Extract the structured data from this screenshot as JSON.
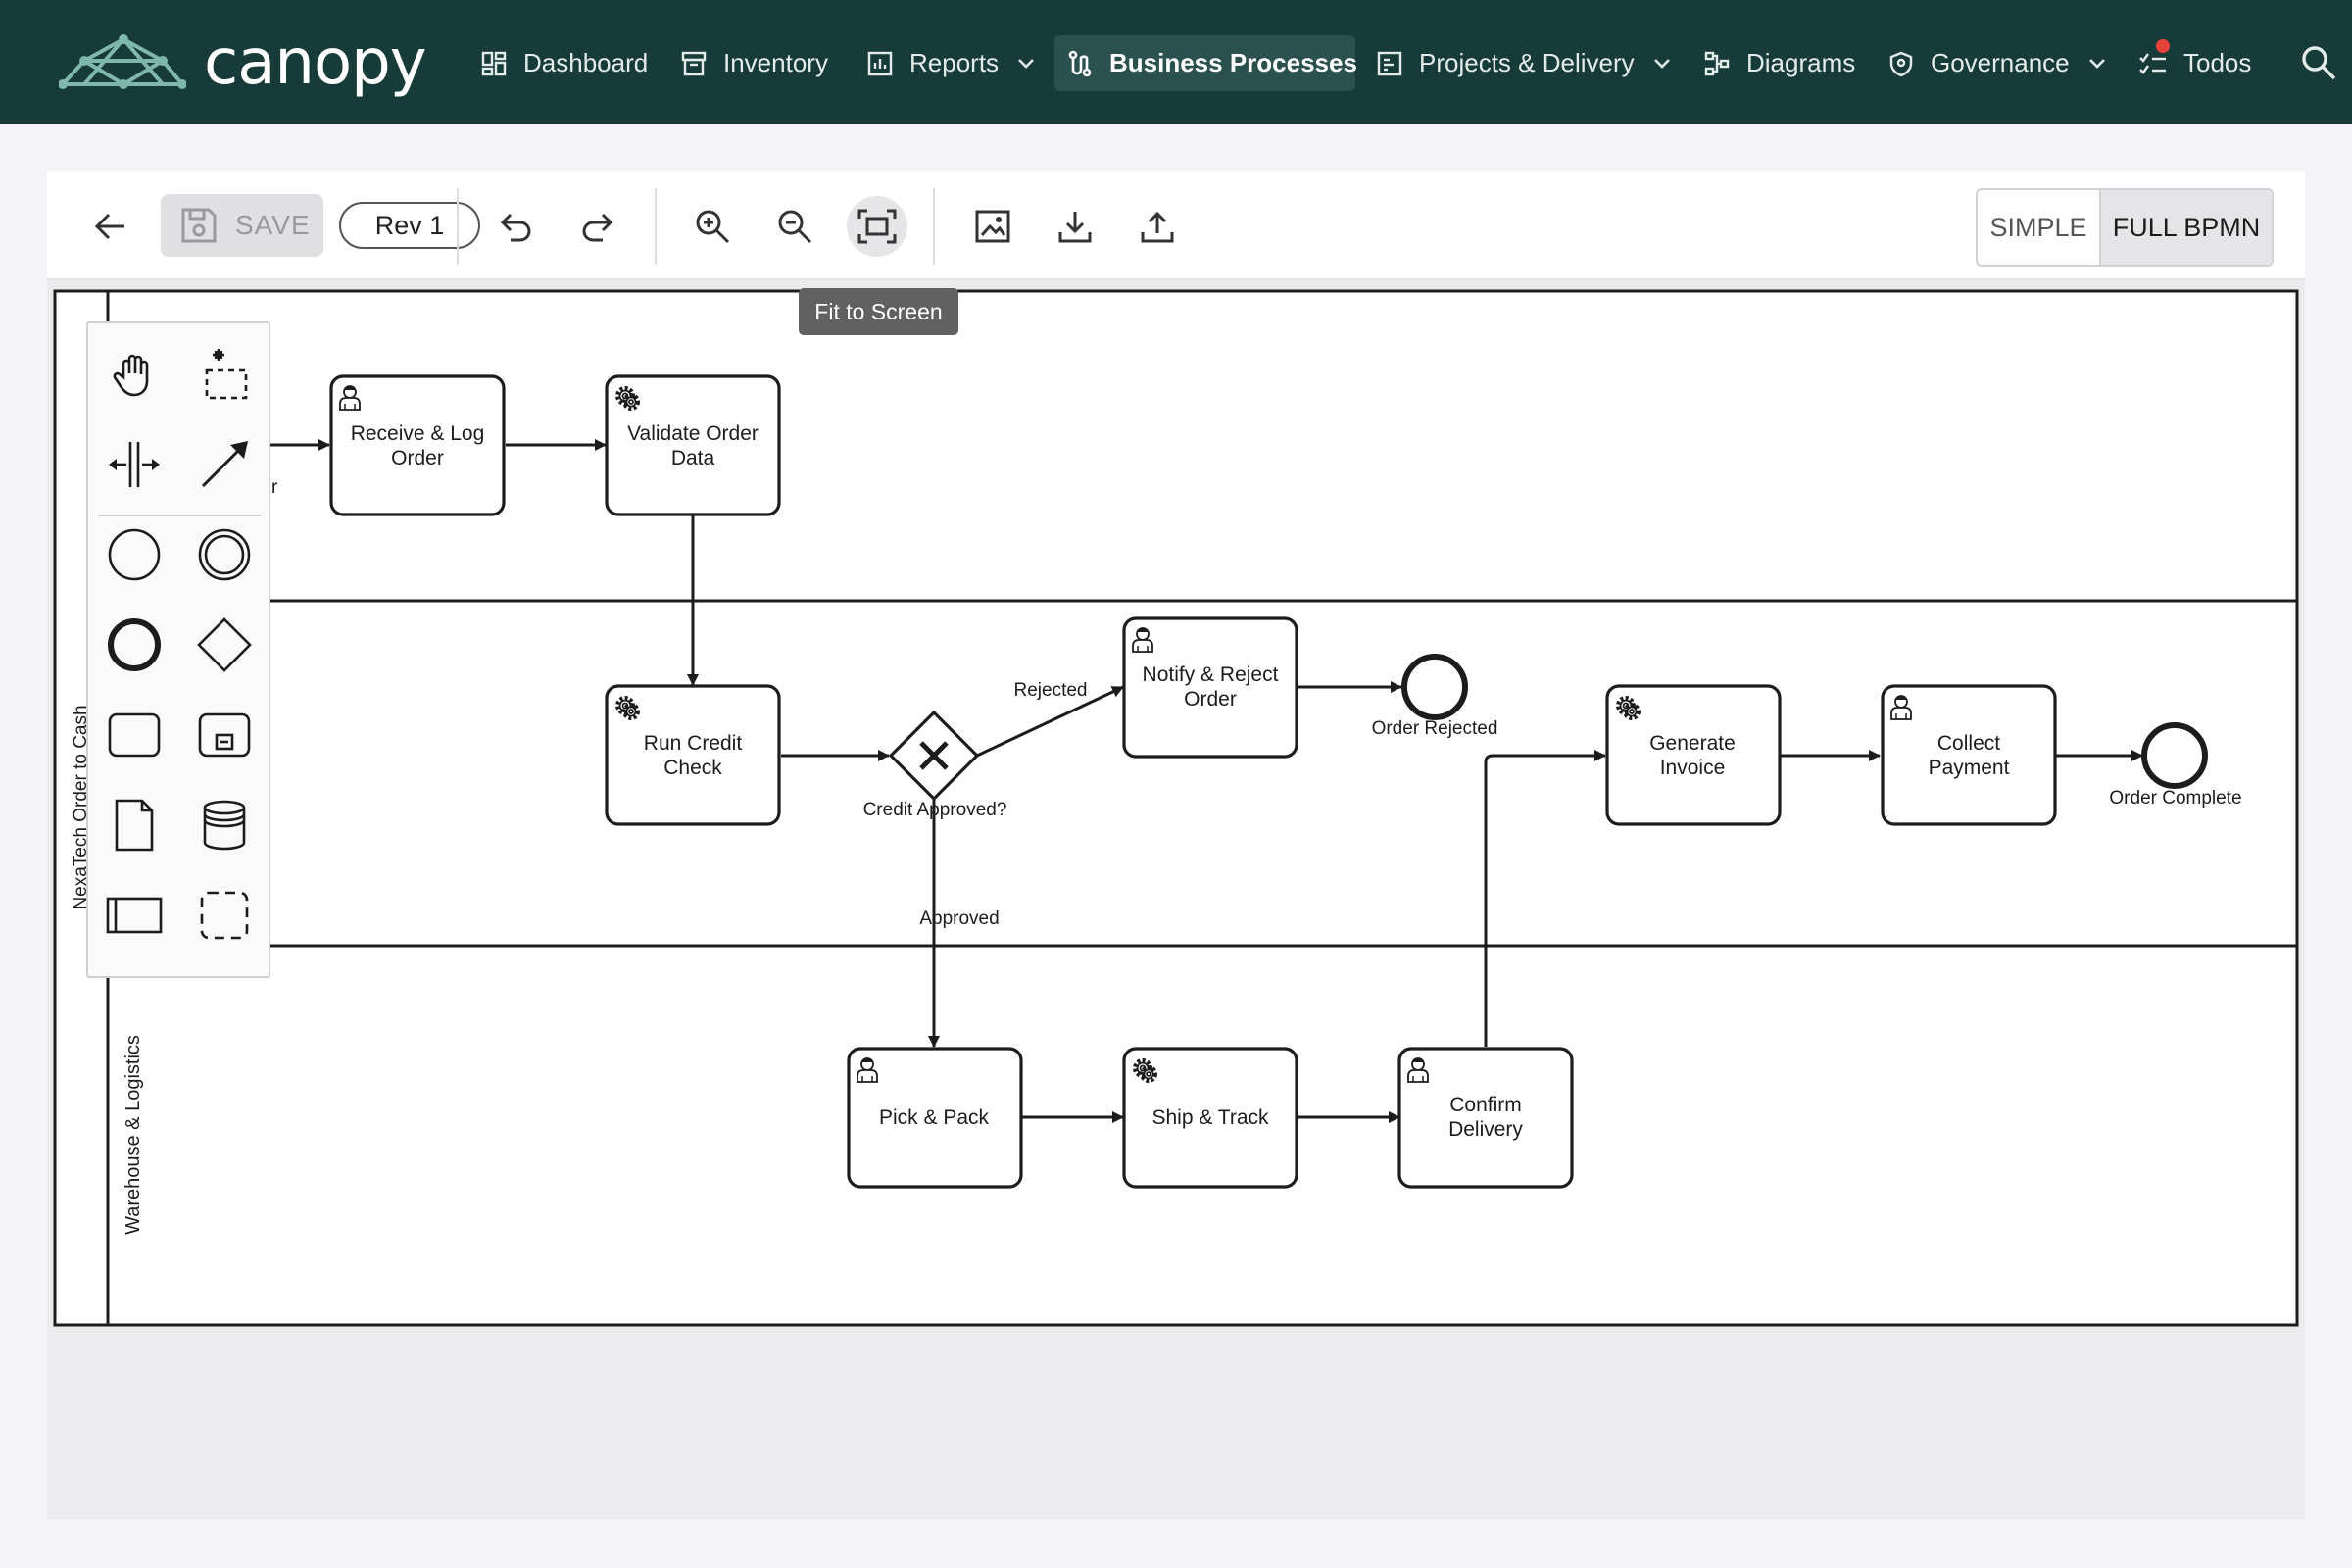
{
  "brand": {
    "name": "canopy"
  },
  "nav": {
    "dashboard": "Dashboard",
    "inventory": "Inventory",
    "reports": "Reports",
    "business_processes": "Business Processes",
    "projects_delivery": "Projects & Delivery",
    "diagrams": "Diagrams",
    "governance": "Governance",
    "todos": "Todos"
  },
  "toolbar": {
    "save_label": "SAVE",
    "revision": "Rev 1",
    "tooltip": "Fit to Screen",
    "mode_simple": "SIMPLE",
    "mode_full": "FULL BPMN",
    "active_mode": "FULL BPMN"
  },
  "diagram": {
    "pool_name": "NexaTech Order to Cash",
    "lanes": [
      "",
      "",
      "Warehouse & Logistics"
    ],
    "tasks": {
      "receive": "Receive & Log Order",
      "validate": "Validate Order Data",
      "credit": "Run Credit Check",
      "notify": "Notify & Reject Order",
      "invoice": "Generate Invoice",
      "payment": "Collect Payment",
      "pick": "Pick & Pack",
      "ship": "Ship & Track",
      "confirm": "Confirm Delivery"
    },
    "gateway": "Credit Approved?",
    "flow_rejected": "Rejected",
    "flow_approved": "Approved",
    "end_rejected": "Order Rejected",
    "end_complete": "Order Complete",
    "partial_label": "r"
  },
  "colors": {
    "nav_bg": "#173b38",
    "nav_active": "#2b514e",
    "todo_badge": "#e8413a",
    "stroke": "#1c1c1c"
  }
}
